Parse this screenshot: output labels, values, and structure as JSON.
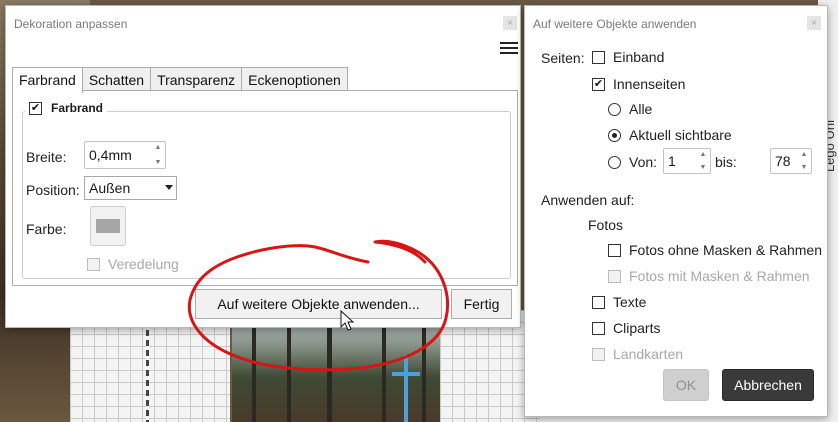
{
  "deco_dialog": {
    "title": "Dekoration anpassen",
    "close_label": "×",
    "tabs": [
      {
        "label": "Farbrand",
        "active": true
      },
      {
        "label": "Schatten",
        "active": false
      },
      {
        "label": "Transparenz",
        "active": false
      },
      {
        "label": "Eckenoptionen",
        "active": false
      }
    ],
    "group": {
      "label": "Farbrand",
      "checked": true
    },
    "width": {
      "label": "Breite:",
      "value": "0,4mm"
    },
    "position": {
      "label": "Position:",
      "value": "Außen"
    },
    "color": {
      "label": "Farbe:",
      "swatch": "#a6a6a6"
    },
    "refinement": {
      "label": "Veredelung",
      "checked": false,
      "disabled": true
    },
    "apply_button": "Auf weitere Objekte anwenden...",
    "done_button": "Fertig"
  },
  "apply_dialog": {
    "title": "Auf weitere Objekte anwenden",
    "close_label": "×",
    "pages_label": "Seiten:",
    "cover": {
      "label": "Einband",
      "checked": false
    },
    "inner_pages": {
      "label": "Innenseiten",
      "checked": true
    },
    "all": {
      "label": "Alle",
      "selected": false
    },
    "visible": {
      "label": "Aktuell sichtbare",
      "selected": true
    },
    "range": {
      "label": "Von:",
      "from": "1",
      "to_label": "bis:",
      "to": "78",
      "selected": false
    },
    "apply_to_label": "Anwenden auf:",
    "photos_label": "Fotos",
    "photos_no_masks": {
      "label": "Fotos ohne Masken & Rahmen",
      "checked": false
    },
    "photos_masks": {
      "label": "Fotos mit Masken & Rahmen",
      "checked": false,
      "disabled": true
    },
    "texts": {
      "label": "Texte",
      "checked": false
    },
    "cliparts": {
      "label": "Cliparts",
      "checked": false
    },
    "maps": {
      "label": "Landkarten",
      "checked": false,
      "disabled": true
    },
    "ok_button": "OK",
    "cancel_button": "Abbrechen"
  },
  "background": {
    "side_text": "Lego Uni"
  },
  "colors": {
    "annotation": "#d81414",
    "cancel_bg": "#3a3a3a"
  }
}
